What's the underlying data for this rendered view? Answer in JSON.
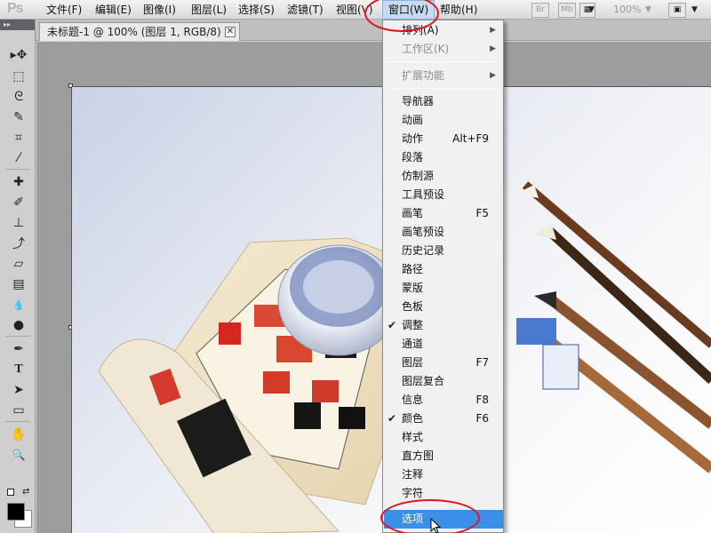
{
  "app": {
    "logo": "Ps"
  },
  "menubar": {
    "items": [
      {
        "label": "文件(F)"
      },
      {
        "label": "编辑(E)"
      },
      {
        "label": "图像(I)"
      },
      {
        "label": "图层(L)"
      },
      {
        "label": "选择(S)"
      },
      {
        "label": "滤镜(T)"
      },
      {
        "label": "视图(V)"
      },
      {
        "label": "窗口(W)"
      },
      {
        "label": "帮助(H)"
      }
    ],
    "bridge_label": "Br",
    "minibridge_label": "Mb",
    "zoom_level": "100%"
  },
  "document": {
    "tab_title": "未标题-1 @ 100% (图层 1, RGB/8) *",
    "close_glyph": "✕"
  },
  "tools": [
    {
      "icon": "move-tool-icon",
      "glyph": "▸✥"
    },
    {
      "icon": "marquee-tool-icon",
      "glyph": "⬚"
    },
    {
      "icon": "lasso-tool-icon",
      "glyph": "ᘓ"
    },
    {
      "icon": "quick-selection-tool-icon",
      "glyph": "✎"
    },
    {
      "icon": "crop-tool-icon",
      "glyph": "⌗"
    },
    {
      "icon": "eyedropper-tool-icon",
      "glyph": "⁄"
    },
    {
      "icon": "healing-brush-tool-icon",
      "glyph": "✚"
    },
    {
      "icon": "brush-tool-icon",
      "glyph": "✐"
    },
    {
      "icon": "clone-stamp-tool-icon",
      "glyph": "⊥"
    },
    {
      "icon": "history-brush-tool-icon",
      "glyph": "⤴"
    },
    {
      "icon": "eraser-tool-icon",
      "glyph": "▱"
    },
    {
      "icon": "gradient-tool-icon",
      "glyph": "▤"
    },
    {
      "icon": "blur-tool-icon",
      "glyph": "💧"
    },
    {
      "icon": "dodge-tool-icon",
      "glyph": "●"
    },
    {
      "icon": "pen-tool-icon",
      "glyph": "✒"
    },
    {
      "icon": "type-tool-icon",
      "glyph": "T"
    },
    {
      "icon": "path-selection-tool-icon",
      "glyph": "➤"
    },
    {
      "icon": "shape-tool-icon",
      "glyph": "▭"
    },
    {
      "icon": "hand-tool-icon",
      "glyph": "✋"
    },
    {
      "icon": "zoom-tool-icon",
      "glyph": "🔍"
    }
  ],
  "window_menu": {
    "items": [
      {
        "label": "排列(A)",
        "submenu": true
      },
      {
        "label": "工作区(K)",
        "submenu": true
      },
      {
        "label": "扩展功能",
        "submenu": true
      },
      {
        "label": "导航器"
      },
      {
        "label": "动画"
      },
      {
        "label": "动作",
        "shortcut": "Alt+F9"
      },
      {
        "label": "段落"
      },
      {
        "label": "仿制源"
      },
      {
        "label": "工具预设"
      },
      {
        "label": "画笔",
        "shortcut": "F5"
      },
      {
        "label": "画笔预设"
      },
      {
        "label": "历史记录"
      },
      {
        "label": "路径"
      },
      {
        "label": "蒙版"
      },
      {
        "label": "色板"
      },
      {
        "label": "调整",
        "checked": true
      },
      {
        "label": "通道"
      },
      {
        "label": "图层",
        "shortcut": "F7"
      },
      {
        "label": "图层复合"
      },
      {
        "label": "信息",
        "shortcut": "F8"
      },
      {
        "label": "颜色",
        "shortcut": "F6",
        "checked": true
      },
      {
        "label": "样式"
      },
      {
        "label": "直方图"
      },
      {
        "label": "注释"
      },
      {
        "label": "字符"
      },
      {
        "label": "选项",
        "highlighted": true
      }
    ],
    "check_glyph": "✔",
    "submenu_arrow": "▶"
  },
  "colors": {
    "highlight": "#3a8fe6",
    "annotation_red": "#e0141c",
    "foreground": "#000000",
    "background": "#ffffff"
  }
}
